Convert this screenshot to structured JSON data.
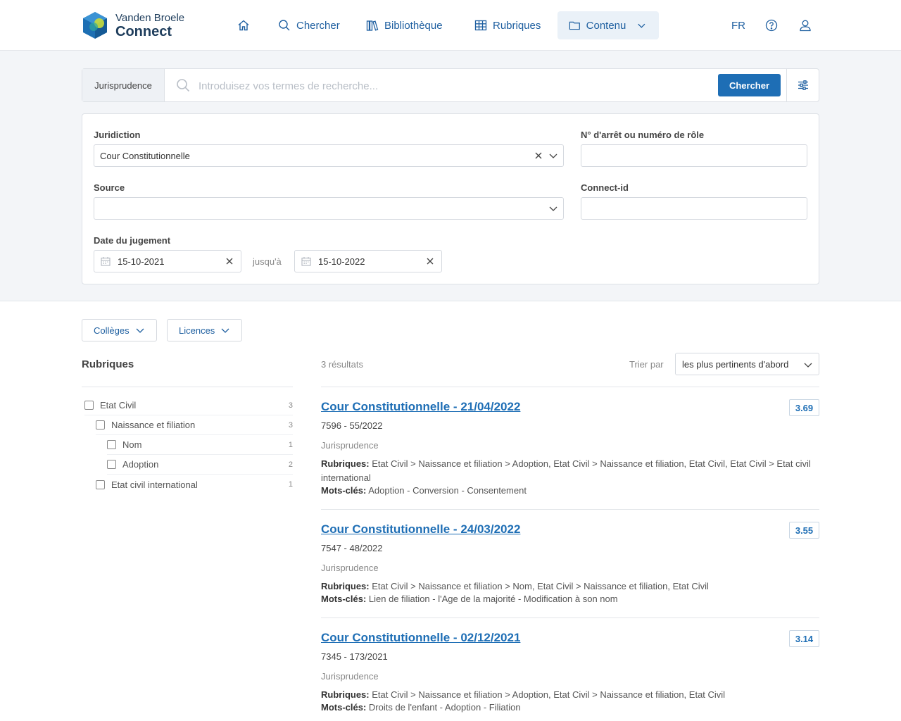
{
  "brand": {
    "line1": "Vanden Broele",
    "line2": "Connect"
  },
  "nav": {
    "search": "Chercher",
    "library": "Bibliothèque",
    "rubrics": "Rubriques",
    "content": "Contenu",
    "language": "FR"
  },
  "search": {
    "scope": "Jurisprudence",
    "placeholder": "Introduisez vos termes de recherche...",
    "button": "Chercher"
  },
  "filters": {
    "jurisdiction_label": "Juridiction",
    "jurisdiction_value": "Cour Constitutionnelle",
    "case_number_label": "N° d'arrêt ou numéro de rôle",
    "source_label": "Source",
    "connect_id_label": "Connect-id",
    "date_label": "Date du jugement",
    "date_from": "15-10-2021",
    "date_until_label": "jusqu'à",
    "date_to": "15-10-2022"
  },
  "facets": {
    "colleges": "Collèges",
    "licences": "Licences"
  },
  "rubriques": {
    "title": "Rubriques",
    "items": [
      {
        "label": "Etat Civil",
        "count": "3"
      },
      {
        "label": "Naissance et filiation",
        "count": "3"
      },
      {
        "label": "Nom",
        "count": "1"
      },
      {
        "label": "Adoption",
        "count": "2"
      },
      {
        "label": "Etat civil international",
        "count": "1"
      }
    ]
  },
  "results": {
    "count_label": "3 résultats",
    "sort_label": "Trier par",
    "sort_value": "les plus pertinents d'abord",
    "rub_prefix": "Rubriques:",
    "mots_prefix": "Mots-clés:",
    "items": [
      {
        "title": "Cour Constitutionnelle - 21/04/2022",
        "score": "3.69",
        "ref": "7596 - 55/2022",
        "type": "Jurisprudence",
        "rubriques": "Etat Civil > Naissance et filiation > Adoption, Etat Civil > Naissance et filiation, Etat Civil, Etat Civil > Etat civil international",
        "mots": "Adoption - Conversion - Consentement"
      },
      {
        "title": "Cour Constitutionnelle - 24/03/2022",
        "score": "3.55",
        "ref": "7547 - 48/2022",
        "type": "Jurisprudence",
        "rubriques": "Etat Civil > Naissance et filiation > Nom, Etat Civil > Naissance et filiation, Etat Civil",
        "mots": "Lien de filiation - l'Age de la majorité - Modification à son nom"
      },
      {
        "title": "Cour Constitutionnelle - 02/12/2021",
        "score": "3.14",
        "ref": "7345 - 173/2021",
        "type": "Jurisprudence",
        "rubriques": "Etat Civil > Naissance et filiation > Adoption, Etat Civil > Naissance et filiation, Etat Civil",
        "mots": "Droits de l'enfant - Adoption - Filiation"
      }
    ]
  }
}
